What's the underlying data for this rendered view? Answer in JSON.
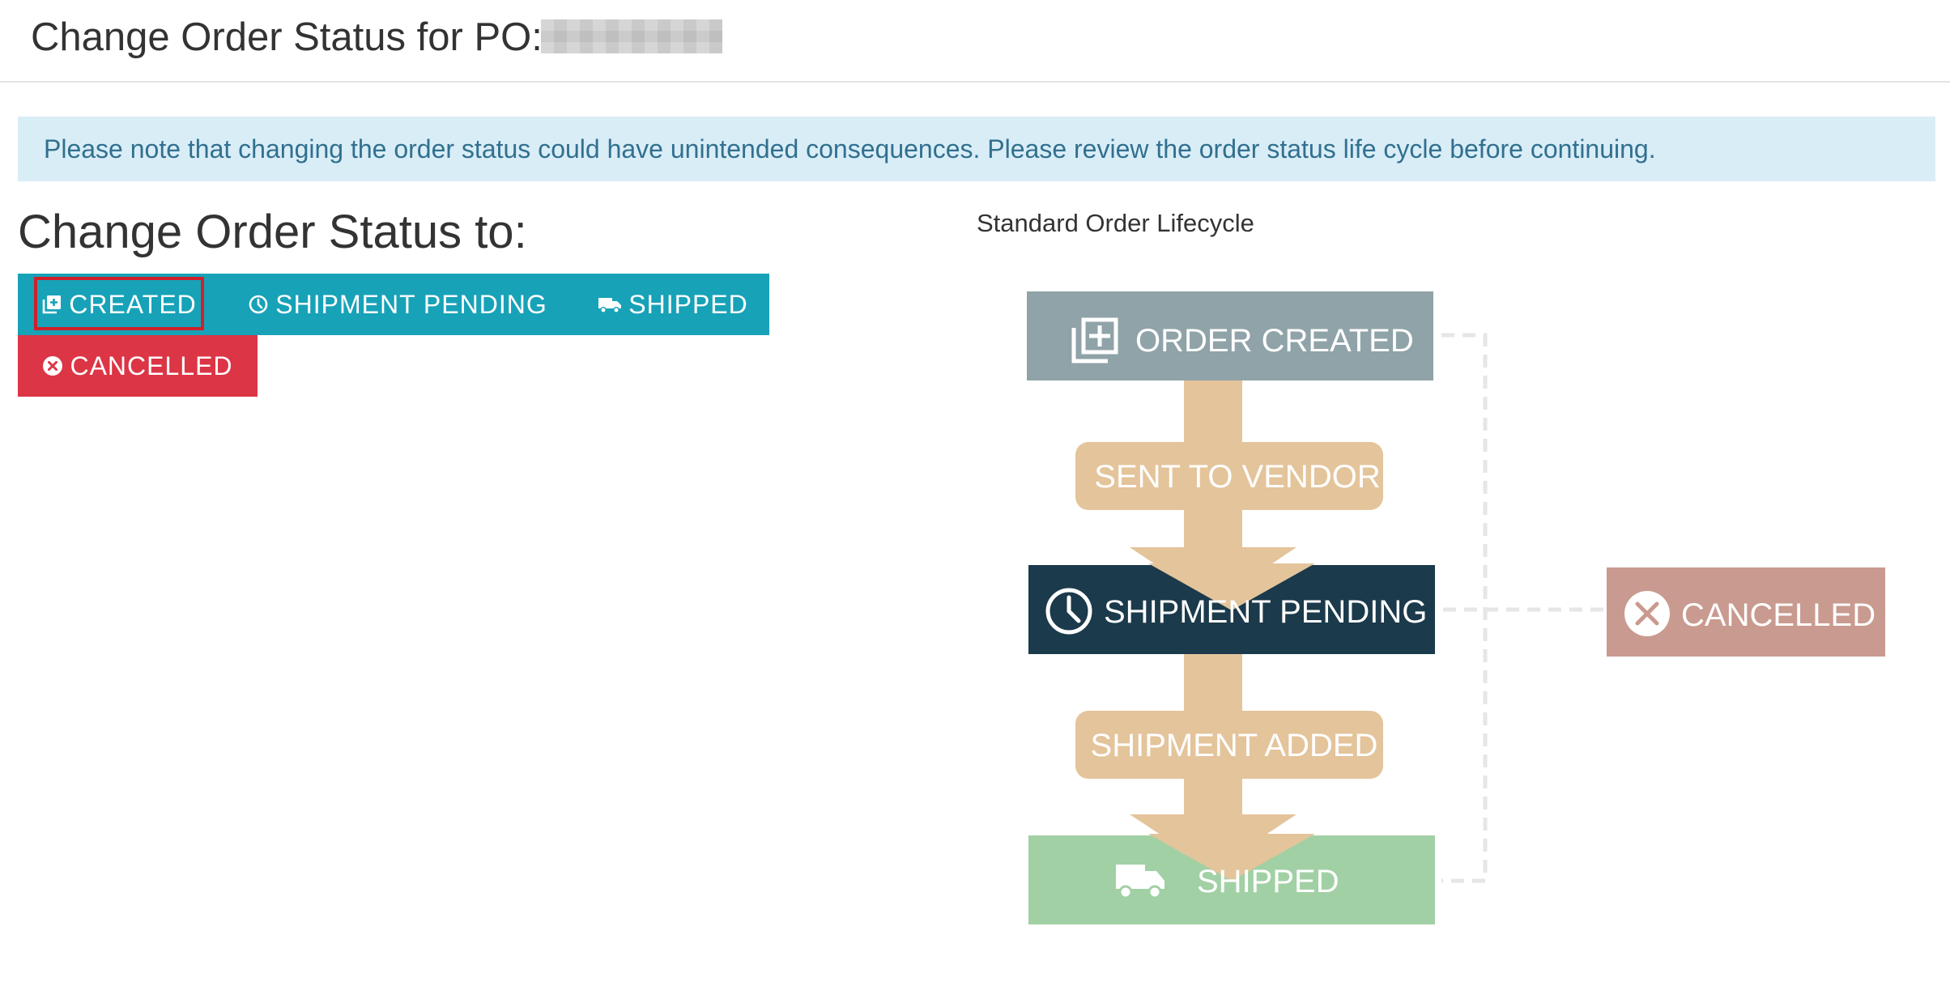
{
  "header": {
    "title": "Change Order Status for PO:"
  },
  "alert": {
    "text": "Please note that changing the order status could have unintended consequences. Please review the order status life cycle before continuing."
  },
  "status_change": {
    "heading": "Change Order Status to:",
    "buttons": [
      {
        "label": "CREATED",
        "icon": "order-created-icon",
        "color": "#17a2b8",
        "selected": true
      },
      {
        "label": "SHIPMENT PENDING",
        "icon": "clock-icon",
        "color": "#17a2b8"
      },
      {
        "label": "SHIPPED",
        "icon": "truck-icon",
        "color": "#17a2b8"
      },
      {
        "label": "CANCELLED",
        "icon": "x-circle-icon",
        "color": "#dc3545"
      }
    ]
  },
  "lifecycle": {
    "label": "Standard Order Lifecycle",
    "states": [
      {
        "label": "ORDER CREATED",
        "icon": "order-created-icon",
        "color": "#8fa3a8"
      },
      {
        "label": "SHIPMENT PENDING",
        "icon": "clock-icon",
        "color": "#1b3a4b"
      },
      {
        "label": "SHIPPED",
        "icon": "truck-icon",
        "color": "#a2d0a5"
      },
      {
        "label": "CANCELLED",
        "icon": "x-circle-icon",
        "color": "#c99a8f"
      }
    ],
    "transitions": [
      {
        "label": "SENT TO VENDOR"
      },
      {
        "label": "SHIPMENT ADDED"
      }
    ],
    "arrow_color": "#e4c49b"
  }
}
